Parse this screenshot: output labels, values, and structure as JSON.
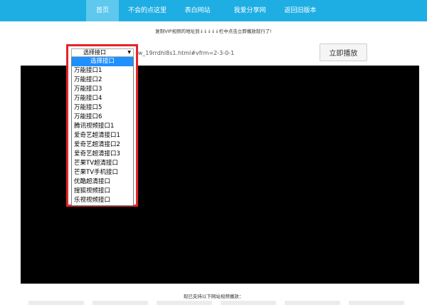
{
  "nav": {
    "items": [
      {
        "label": "首页",
        "active": true
      },
      {
        "label": "不会的点这里",
        "active": false
      },
      {
        "label": "表白网站",
        "active": false
      },
      {
        "label": "我爱分享网",
        "active": false
      },
      {
        "label": "返回旧版本",
        "active": false
      }
    ]
  },
  "instruction": "复制VIP视频的地址到↓↓↓↓↓栏中点击立即播放就行了!",
  "toolbar": {
    "url_value": "http://www.iqiyi.com/w_19rrdhl8s1.html#vfrm=2-3-0-1",
    "play_label": "立即播放"
  },
  "dropdown": {
    "selected": "选择接口",
    "options": [
      "选择接口",
      "万能接口1",
      "万能接口2",
      "万能接口3",
      "万能接口4",
      "万能接口5",
      "万能接口6",
      "腾讯视频接口1",
      "爱奇艺超清接口1",
      "爱奇艺超清接口2",
      "爱奇艺超清接口3",
      "芒果TV超清接口",
      "芒果TV手机接口",
      "优酷超清接口",
      "搜狐视频接口",
      "乐视视频接口"
    ]
  },
  "supported_label": "现已支持以下网站视频播放：",
  "colors": {
    "nav_bg": "#1eaee3",
    "nav_active": "#5ec8ef",
    "highlight_border": "#e3242b",
    "selected_option": "#1e90ff",
    "player_bg": "#000000"
  }
}
